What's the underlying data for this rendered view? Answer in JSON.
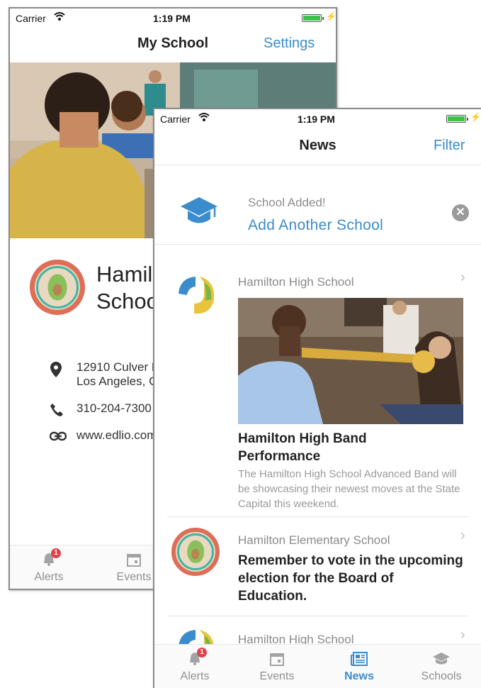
{
  "back_screen": {
    "status": {
      "carrier": "Carrier",
      "time": "1:19 PM"
    },
    "nav": {
      "title": "My School",
      "action": "Settings"
    },
    "school": {
      "name_line1": "Hamil",
      "name_line2": "Schoo"
    },
    "info": {
      "address_line1": "12910 Culver B",
      "address_line2": "Los Angeles, C",
      "phone": "310-204-7300",
      "website": "www.edlio.com"
    },
    "tabs": [
      {
        "label": "Alerts",
        "badge": "1",
        "icon": "bell-icon"
      },
      {
        "label": "Events",
        "icon": "calendar-icon"
      }
    ]
  },
  "front_screen": {
    "status": {
      "carrier": "Carrier",
      "time": "1:19 PM"
    },
    "nav": {
      "title": "News",
      "action": "Filter"
    },
    "banner": {
      "small_text": "School Added!",
      "link_text": "Add Another School",
      "icon": "graduation-cap-icon"
    },
    "news": [
      {
        "source": "Hamilton High School",
        "title": "Hamilton High Band Performance",
        "body": "The Hamilton High School Advanced Band will be showcasing their newest moves at the State Capital this weekend."
      },
      {
        "source": "Hamilton Elementary School",
        "title": "Remember to vote in the upcoming election for the Board of Education."
      },
      {
        "source": "Hamilton High School"
      }
    ],
    "tabs": [
      {
        "label": "Alerts",
        "badge": "1",
        "icon": "bell-icon"
      },
      {
        "label": "Events",
        "icon": "calendar-icon"
      },
      {
        "label": "News",
        "icon": "newspaper-icon",
        "active": true
      },
      {
        "label": "Schools",
        "icon": "graduation-cap-icon"
      }
    ]
  },
  "colors": {
    "accent": "#3a8ccc",
    "badge": "#e0424b",
    "battery": "#3cc44a",
    "logo_blue": "#3a8ccc",
    "logo_yellow": "#e9c33c"
  }
}
